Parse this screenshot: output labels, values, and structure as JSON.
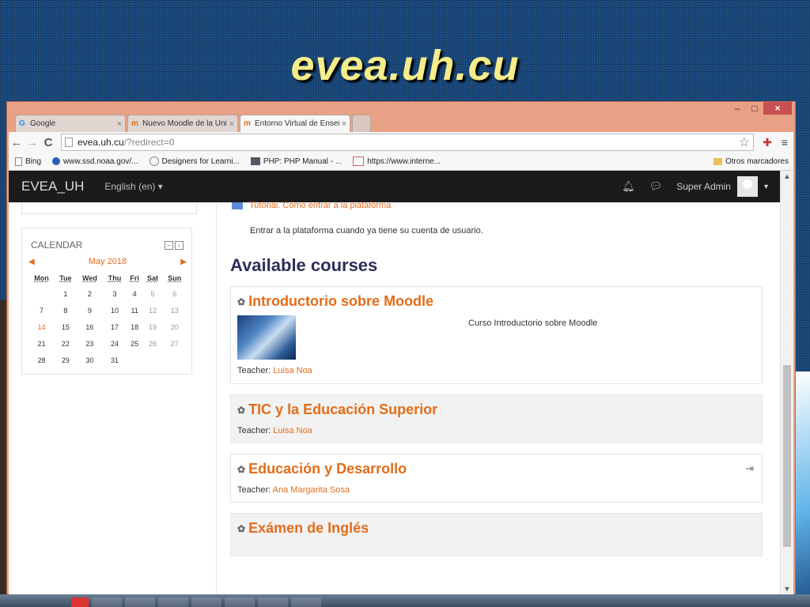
{
  "slide": {
    "title": "evea.uh.cu"
  },
  "window": {
    "minimize": "–",
    "maximize": "□",
    "close": "×"
  },
  "tabs": [
    {
      "label": "Google",
      "fav": "G",
      "close": "×",
      "active": false
    },
    {
      "label": "Nuevo Moodle de la Unive",
      "fav": "m",
      "close": "×",
      "active": false
    },
    {
      "label": "Entorno Virtual de Enseñan",
      "fav": "m",
      "close": "×",
      "active": true
    }
  ],
  "toolbar": {
    "back": "←",
    "forward": "→",
    "reload": "C",
    "url_host": "evea.uh.cu",
    "url_path": "/?redirect=0",
    "star": "☆",
    "menu": "≡"
  },
  "bookmarks": [
    {
      "label": "Bing",
      "icon": "page-icon"
    },
    {
      "label": "www.ssd.noaa.gov/...",
      "icon": "shield-icon"
    },
    {
      "label": "Designers for Learni...",
      "icon": "circle-icon"
    },
    {
      "label": "PHP: PHP Manual - ...",
      "icon": "php-icon"
    },
    {
      "label": "https://www.interne...",
      "icon": "ws-icon"
    }
  ],
  "bookmarks_other": "Otros marcadores",
  "navbar": {
    "brand": "EVEA_UH",
    "language": "English (en) ▾",
    "user": "Super Admin",
    "caret": "▾"
  },
  "calendar": {
    "title": "CALENDAR",
    "month": "May 2018",
    "prev": "◀",
    "next": "▶",
    "days": [
      "Mon",
      "Tue",
      "Wed",
      "Thu",
      "Fri",
      "Sat",
      "Sun"
    ],
    "weeks": [
      [
        "",
        "1",
        "2",
        "3",
        "4",
        "5",
        "6"
      ],
      [
        "7",
        "8",
        "9",
        "10",
        "11",
        "12",
        "13"
      ],
      [
        "14",
        "15",
        "16",
        "17",
        "18",
        "19",
        "20"
      ],
      [
        "21",
        "22",
        "23",
        "24",
        "25",
        "26",
        "27"
      ],
      [
        "28",
        "29",
        "30",
        "31",
        "",
        "",
        ""
      ]
    ],
    "today": "14"
  },
  "main": {
    "tutorial_link": "Tutorial. Cómo entrar a la plataforma",
    "tutorial_desc": "Entrar a la plataforma cuando ya tiene su cuenta de usuario.",
    "available_title": "Available courses"
  },
  "courses": [
    {
      "name": "Introductorio sobre Moodle",
      "summary": "Curso Introductorio sobre Moodle",
      "teacher_label": "Teacher:",
      "teacher": "Luisa Noa"
    },
    {
      "name": "TIC y la Educación Superior",
      "teacher_label": "Teacher:",
      "teacher": "Luisa Noa"
    },
    {
      "name": "Educación y Desarrollo",
      "teacher_label": "Teacher:",
      "teacher": "Ana Margarita Sosa"
    },
    {
      "name": "Exámen de Inglés"
    }
  ]
}
